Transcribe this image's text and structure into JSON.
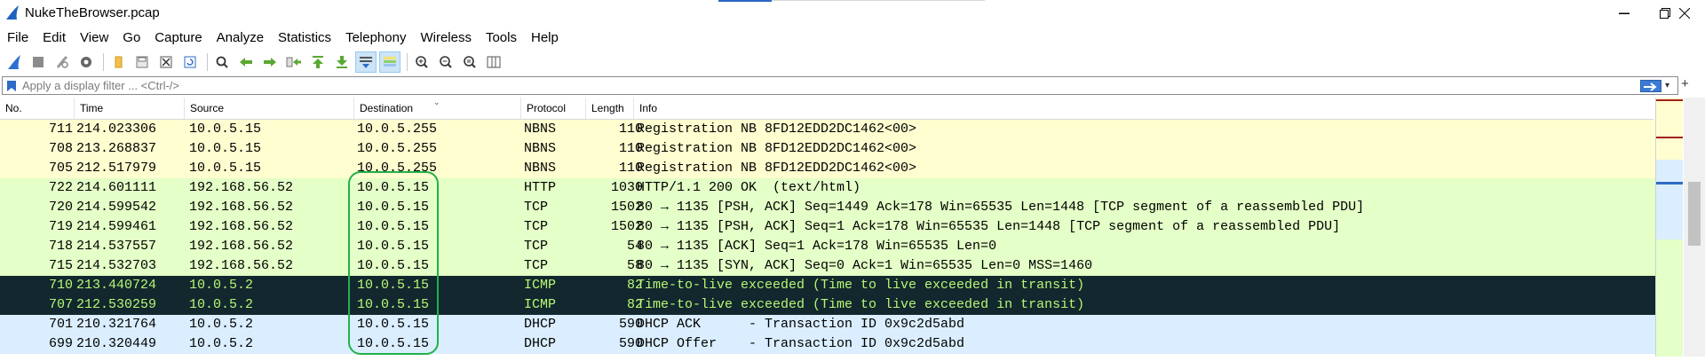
{
  "window": {
    "title": "NukeTheBrowser.pcap",
    "controls": {
      "minimize": "—",
      "maximize": "❐",
      "close": "✕"
    }
  },
  "menu": [
    "File",
    "Edit",
    "View",
    "Go",
    "Capture",
    "Analyze",
    "Statistics",
    "Telephony",
    "Wireless",
    "Tools",
    "Help"
  ],
  "toolbar": {
    "icons": [
      "shark-fin-start-icon",
      "stop-capture-icon",
      "restart-capture-icon",
      "capture-options-icon",
      "open-file-icon",
      "save-file-icon",
      "close-file-icon",
      "reload-file-icon",
      "find-packet-icon",
      "go-back-icon",
      "go-forward-icon",
      "go-to-packet-icon",
      "go-first-icon",
      "go-last-icon",
      "autoscroll-icon",
      "colorize-icon",
      "zoom-in-icon",
      "zoom-out-icon",
      "zoom-normal-icon",
      "resize-columns-icon"
    ]
  },
  "filter": {
    "placeholder": "Apply a display filter ... <Ctrl-/>",
    "value": ""
  },
  "columns": [
    "No.",
    "Time",
    "Source",
    "Destination",
    "Protocol",
    "Length",
    "Info"
  ],
  "colors": {
    "nbns_bg": "#fefed0",
    "tcp_bg": "#e4ffc7",
    "icmp_bg": "#12272e",
    "icmp_fg": "#b7f774",
    "dhcp_bg": "#daeeff",
    "annotation": "#22b14c"
  },
  "packets": [
    {
      "no": "711",
      "time": "214.023306",
      "src": "10.0.5.15",
      "dst": "10.0.5.255",
      "proto": "NBNS",
      "len": "110",
      "info": "Registration NB 8FD12EDD2DC1462<00>",
      "type": "nbns"
    },
    {
      "no": "708",
      "time": "213.268837",
      "src": "10.0.5.15",
      "dst": "10.0.5.255",
      "proto": "NBNS",
      "len": "110",
      "info": "Registration NB 8FD12EDD2DC1462<00>",
      "type": "nbns"
    },
    {
      "no": "705",
      "time": "212.517979",
      "src": "10.0.5.15",
      "dst": "10.0.5.255",
      "proto": "NBNS",
      "len": "110",
      "info": "Registration NB 8FD12EDD2DC1462<00>",
      "type": "nbns"
    },
    {
      "no": "722",
      "time": "214.601111",
      "src": "192.168.56.52",
      "dst": "10.0.5.15",
      "proto": "HTTP",
      "len": "1030",
      "info": "HTTP/1.1 200 OK  (text/html)",
      "type": "tcp"
    },
    {
      "no": "720",
      "time": "214.599542",
      "src": "192.168.56.52",
      "dst": "10.0.5.15",
      "proto": "TCP",
      "len": "1502",
      "info": "80 → 1135 [PSH, ACK] Seq=1449 Ack=178 Win=65535 Len=1448 [TCP segment of a reassembled PDU]",
      "type": "tcp"
    },
    {
      "no": "719",
      "time": "214.599461",
      "src": "192.168.56.52",
      "dst": "10.0.5.15",
      "proto": "TCP",
      "len": "1502",
      "info": "80 → 1135 [PSH, ACK] Seq=1 Ack=178 Win=65535 Len=1448 [TCP segment of a reassembled PDU]",
      "type": "tcp"
    },
    {
      "no": "718",
      "time": "214.537557",
      "src": "192.168.56.52",
      "dst": "10.0.5.15",
      "proto": "TCP",
      "len": "54",
      "info": "80 → 1135 [ACK] Seq=1 Ack=178 Win=65535 Len=0",
      "type": "tcp"
    },
    {
      "no": "715",
      "time": "214.532703",
      "src": "192.168.56.52",
      "dst": "10.0.5.15",
      "proto": "TCP",
      "len": "58",
      "info": "80 → 1135 [SYN, ACK] Seq=0 Ack=1 Win=65535 Len=0 MSS=1460",
      "type": "tcp"
    },
    {
      "no": "710",
      "time": "213.440724",
      "src": "10.0.5.2",
      "dst": "10.0.5.15",
      "proto": "ICMP",
      "len": "82",
      "info": "Time-to-live exceeded (Time to live exceeded in transit)",
      "type": "icmp"
    },
    {
      "no": "707",
      "time": "212.530259",
      "src": "10.0.5.2",
      "dst": "10.0.5.15",
      "proto": "ICMP",
      "len": "82",
      "info": "Time-to-live exceeded (Time to live exceeded in transit)",
      "type": "icmp"
    },
    {
      "no": "701",
      "time": "210.321764",
      "src": "10.0.5.2",
      "dst": "10.0.5.15",
      "proto": "DHCP",
      "len": "590",
      "info": "DHCP ACK      - Transaction ID 0x9c2d5abd",
      "type": "dhcp"
    },
    {
      "no": "699",
      "time": "210.320449",
      "src": "10.0.5.2",
      "dst": "10.0.5.15",
      "proto": "DHCP",
      "len": "590",
      "info": "DHCP Offer    - Transaction ID 0x9c2d5abd",
      "type": "dhcp"
    }
  ]
}
